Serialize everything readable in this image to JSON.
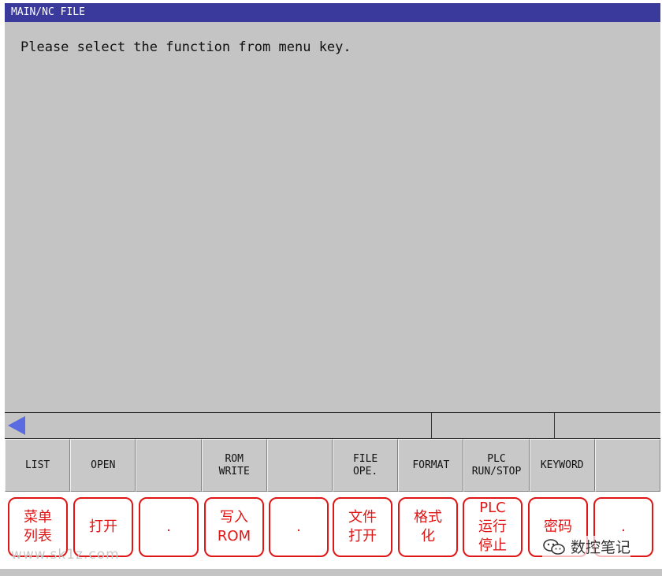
{
  "titlebar": {
    "title": "MAIN/NC FILE"
  },
  "message": "Please select the function from menu key.",
  "softkeys": [
    {
      "label": "LIST"
    },
    {
      "label": "OPEN"
    },
    {
      "label": ""
    },
    {
      "label": "ROM\nWRITE"
    },
    {
      "label": ""
    },
    {
      "label": "FILE\nOPE."
    },
    {
      "label": "FORMAT"
    },
    {
      "label": "PLC\nRUN/STOP"
    },
    {
      "label": "KEYWORD"
    },
    {
      "label": ""
    }
  ],
  "annotations": [
    {
      "text": "菜单\n列表"
    },
    {
      "text": "打开"
    },
    {
      "text": "."
    },
    {
      "text": "写入\nROM"
    },
    {
      "text": "."
    },
    {
      "text": "文件\n打开"
    },
    {
      "text": "格式\n化"
    },
    {
      "text": "PLC\n运行\n停止"
    },
    {
      "text": "密码"
    },
    {
      "text": "."
    }
  ],
  "watermark": {
    "site": "www.sk1z.com",
    "brand": "数控笔记"
  },
  "colors": {
    "titlebar_bg": "#3a3a9c",
    "screen_bg": "#c4c4c4",
    "annotation_red": "#e01515",
    "arrow_blue": "#5a6ae0"
  }
}
